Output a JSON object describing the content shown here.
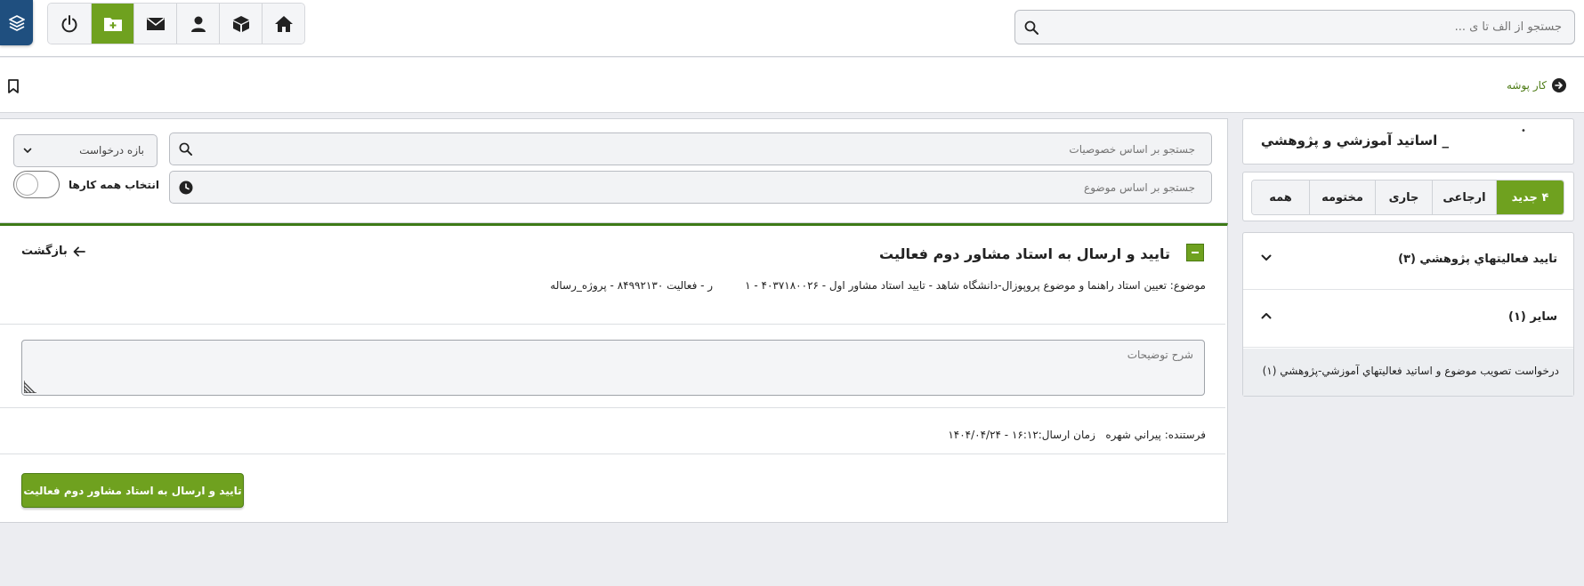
{
  "topbar": {
    "search_placeholder": "جستجو از الف تا ی ...",
    "toolbar_icons": [
      "power-icon",
      "add-folder-icon",
      "mail-icon",
      "user-icon",
      "box-icon",
      "home-icon"
    ],
    "active_icon": "add-folder-icon"
  },
  "breadcrumb": {
    "label": "کار پوشه"
  },
  "right_panel": {
    "title": "_ اساتید آموزشي و پژوهشي",
    "title_mark": "•",
    "tabs": [
      {
        "label": "۴ جدید",
        "active": true
      },
      {
        "label": "ارجاعی",
        "active": false
      },
      {
        "label": "جاری",
        "active": false
      },
      {
        "label": "مختومه",
        "active": false
      },
      {
        "label": "همه",
        "active": false
      }
    ],
    "accordion": [
      {
        "label": "تاييد فعاليتهاي پژوهشي (۳)",
        "expanded": false
      },
      {
        "label": "ساير (۱)",
        "expanded": true,
        "items": [
          "درخواست تصويب موضوع و اساتيد فعاليتهاي آموزشي-پژوهشي (۱)"
        ]
      }
    ]
  },
  "filters": {
    "search_by_props": "جستجو بر اساس خصوصیات",
    "search_by_subject": "جستجو بر اساس موضوع",
    "period_label": "بازه درخواست",
    "select_all_label": "انتخاب همه کارها"
  },
  "activity": {
    "title": "تاييد و ارسال به استاد مشاور دوم فعاليت",
    "back_label": "بازگشت",
    "subject_main": "موضوع: تعيين استاد راهنما و موضوع پروپوزال-دانشگاه شاهد - تاييد استاد مشاور اول - ۴۰۳۷۱۸۰۰۲۶ - ۱",
    "subject_tail": "ر - فعاليت ۸۴۹۹۲۱۳۰ - پروژه_رساله",
    "description_placeholder": "شرح توضيحات",
    "sender_label": "فرستنده: پيراني شهره",
    "sent_time": "زمان ارسال:۱۶:۱۲ - ۱۴۰۴/۰۴/۲۴",
    "submit_label": "تاييد و ارسال به استاد مشاور دوم فعاليت"
  },
  "colors": {
    "accent": "#6fa11f",
    "accent_dark": "#3d7a17",
    "logo_bg": "#1f4f7f",
    "background": "#ecedf1"
  }
}
